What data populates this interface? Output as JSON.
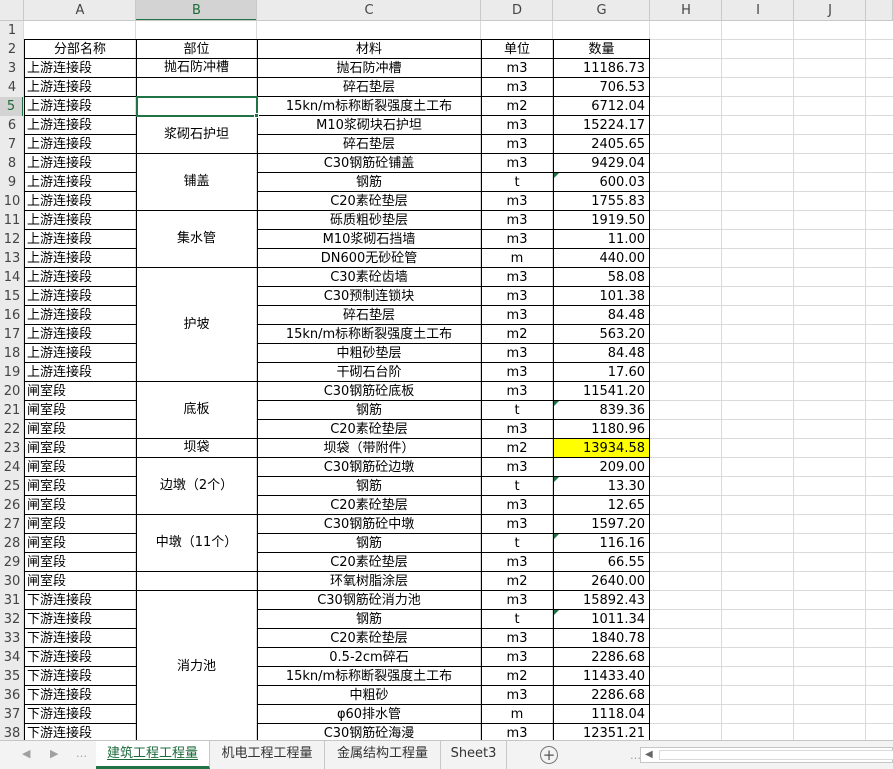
{
  "columns": [
    "A",
    "B",
    "C",
    "D",
    "G",
    "H",
    "I",
    "J"
  ],
  "selected_column": "B",
  "selected_row": 5,
  "header_row": {
    "a": "分部名称",
    "b": "部位",
    "c": "材料",
    "d": "单位",
    "g": "数量"
  },
  "rows": [
    {
      "n": 3,
      "a": "上游连接段",
      "c": "抛石防冲槽",
      "d": "m3",
      "g": "11186.73"
    },
    {
      "n": 4,
      "a": "上游连接段",
      "c": "碎石垫层",
      "d": "m3",
      "g": "706.53"
    },
    {
      "n": 5,
      "a": "上游连接段",
      "c": "15kn/m标称断裂强度土工布",
      "d": "m2",
      "g": "6712.04"
    },
    {
      "n": 6,
      "a": "上游连接段",
      "c": "M10浆砌块石护坦",
      "d": "m3",
      "g": "15224.17"
    },
    {
      "n": 7,
      "a": "上游连接段",
      "c": "碎石垫层",
      "d": "m3",
      "g": "2405.65"
    },
    {
      "n": 8,
      "a": "上游连接段",
      "c": "C30钢筋砼铺盖",
      "d": "m3",
      "g": "9429.04"
    },
    {
      "n": 9,
      "a": "上游连接段",
      "c": "钢筋",
      "d": "t",
      "g": "600.03"
    },
    {
      "n": 10,
      "a": "上游连接段",
      "c": "C20素砼垫层",
      "d": "m3",
      "g": "1755.83"
    },
    {
      "n": 11,
      "a": "上游连接段",
      "c": "砾质粗砂垫层",
      "d": "m3",
      "g": "1919.50"
    },
    {
      "n": 12,
      "a": "上游连接段",
      "c": "M10浆砌石挡墙",
      "d": "m3",
      "g": "11.00"
    },
    {
      "n": 13,
      "a": "上游连接段",
      "c": "DN600无砂砼管",
      "d": "m",
      "g": "440.00"
    },
    {
      "n": 14,
      "a": "上游连接段",
      "c": "C30素砼齿墙",
      "d": "m3",
      "g": "58.08"
    },
    {
      "n": 15,
      "a": "上游连接段",
      "c": "C30预制连锁块",
      "d": "m3",
      "g": "101.38"
    },
    {
      "n": 16,
      "a": "上游连接段",
      "c": "碎石垫层",
      "d": "m3",
      "g": "84.48"
    },
    {
      "n": 17,
      "a": "上游连接段",
      "c": "15kn/m标称断裂强度土工布",
      "d": "m2",
      "g": "563.20"
    },
    {
      "n": 18,
      "a": "上游连接段",
      "c": "中粗砂垫层",
      "d": "m3",
      "g": "84.48"
    },
    {
      "n": 19,
      "a": "上游连接段",
      "c": "干砌石台阶",
      "d": "m3",
      "g": "17.60"
    },
    {
      "n": 20,
      "a": "闸室段",
      "c": "C30钢筋砼底板",
      "d": "m3",
      "g": "11541.20"
    },
    {
      "n": 21,
      "a": "闸室段",
      "c": "钢筋",
      "d": "t",
      "g": "839.36"
    },
    {
      "n": 22,
      "a": "闸室段",
      "c": "C20素砼垫层",
      "d": "m3",
      "g": "1180.96"
    },
    {
      "n": 23,
      "a": "闸室段",
      "c": "坝袋（带附件）",
      "d": "m2",
      "g": "13934.58"
    },
    {
      "n": 24,
      "a": "闸室段",
      "c": "C30钢筋砼边墩",
      "d": "m3",
      "g": "209.00"
    },
    {
      "n": 25,
      "a": "闸室段",
      "c": "钢筋",
      "d": "t",
      "g": "13.30"
    },
    {
      "n": 26,
      "a": "闸室段",
      "c": "C20素砼垫层",
      "d": "m3",
      "g": "12.65"
    },
    {
      "n": 27,
      "a": "闸室段",
      "c": "C30钢筋砼中墩",
      "d": "m3",
      "g": "1597.20"
    },
    {
      "n": 28,
      "a": "闸室段",
      "c": "钢筋",
      "d": "t",
      "g": "116.16"
    },
    {
      "n": 29,
      "a": "闸室段",
      "c": "C20素砼垫层",
      "d": "m3",
      "g": "66.55"
    },
    {
      "n": 30,
      "a": "闸室段",
      "c": "环氧树脂涂层",
      "d": "m2",
      "g": "2640.00"
    },
    {
      "n": 31,
      "a": "下游连接段",
      "c": "C30钢筋砼消力池",
      "d": "m3",
      "g": "15892.43"
    },
    {
      "n": 32,
      "a": "下游连接段",
      "c": "钢筋",
      "d": "t",
      "g": "1011.34"
    },
    {
      "n": 33,
      "a": "下游连接段",
      "c": "C20素砼垫层",
      "d": "m3",
      "g": "1840.78"
    },
    {
      "n": 34,
      "a": "下游连接段",
      "c": "0.5-2cm碎石",
      "d": "m3",
      "g": "2286.68"
    },
    {
      "n": 35,
      "a": "下游连接段",
      "c": "15kn/m标称断裂强度土工布",
      "d": "m2",
      "g": "11433.40"
    },
    {
      "n": 36,
      "a": "下游连接段",
      "c": "中粗砂",
      "d": "m3",
      "g": "2286.68"
    },
    {
      "n": 37,
      "a": "下游连接段",
      "c": "φ60排水管",
      "d": "m",
      "g": "1118.04"
    },
    {
      "n": 38,
      "a": "下游连接段",
      "c": "C30钢筋砼海漫",
      "d": "m3",
      "g": "12351.21"
    }
  ],
  "merged_b": [
    {
      "from": 3,
      "to": 3,
      "text": "抛石防冲槽"
    },
    {
      "from": 5,
      "to": 5,
      "text": ""
    },
    {
      "from": 6,
      "to": 7,
      "text": "浆砌石护坦"
    },
    {
      "from": 8,
      "to": 10,
      "text": "铺盖"
    },
    {
      "from": 11,
      "to": 13,
      "text": "集水管"
    },
    {
      "from": 14,
      "to": 19,
      "text": "护坡"
    },
    {
      "from": 20,
      "to": 22,
      "text": "底板"
    },
    {
      "from": 23,
      "to": 23,
      "text": "坝袋"
    },
    {
      "from": 24,
      "to": 26,
      "text": "边墩（2个）"
    },
    {
      "from": 27,
      "to": 29,
      "text": "中墩（11个）"
    },
    {
      "from": 30,
      "to": 30,
      "text": ""
    },
    {
      "from": 31,
      "to": 38,
      "text": "消力池"
    }
  ],
  "highlighted_row": 23,
  "highlight_color": "#ffff00",
  "comment_rows": [
    9,
    21,
    25,
    28,
    32
  ],
  "tabs": [
    {
      "label": "建筑工程工程量",
      "active": true
    },
    {
      "label": "机电工程工程量",
      "active": false
    },
    {
      "label": "金属结构工程量",
      "active": false
    },
    {
      "label": "Sheet3",
      "active": false
    }
  ],
  "add_sheet_glyph": "+",
  "nav": {
    "prev": "◀",
    "next": "▶",
    "more": "…",
    "scroll_left": "◀"
  },
  "accent_color": "#217346"
}
